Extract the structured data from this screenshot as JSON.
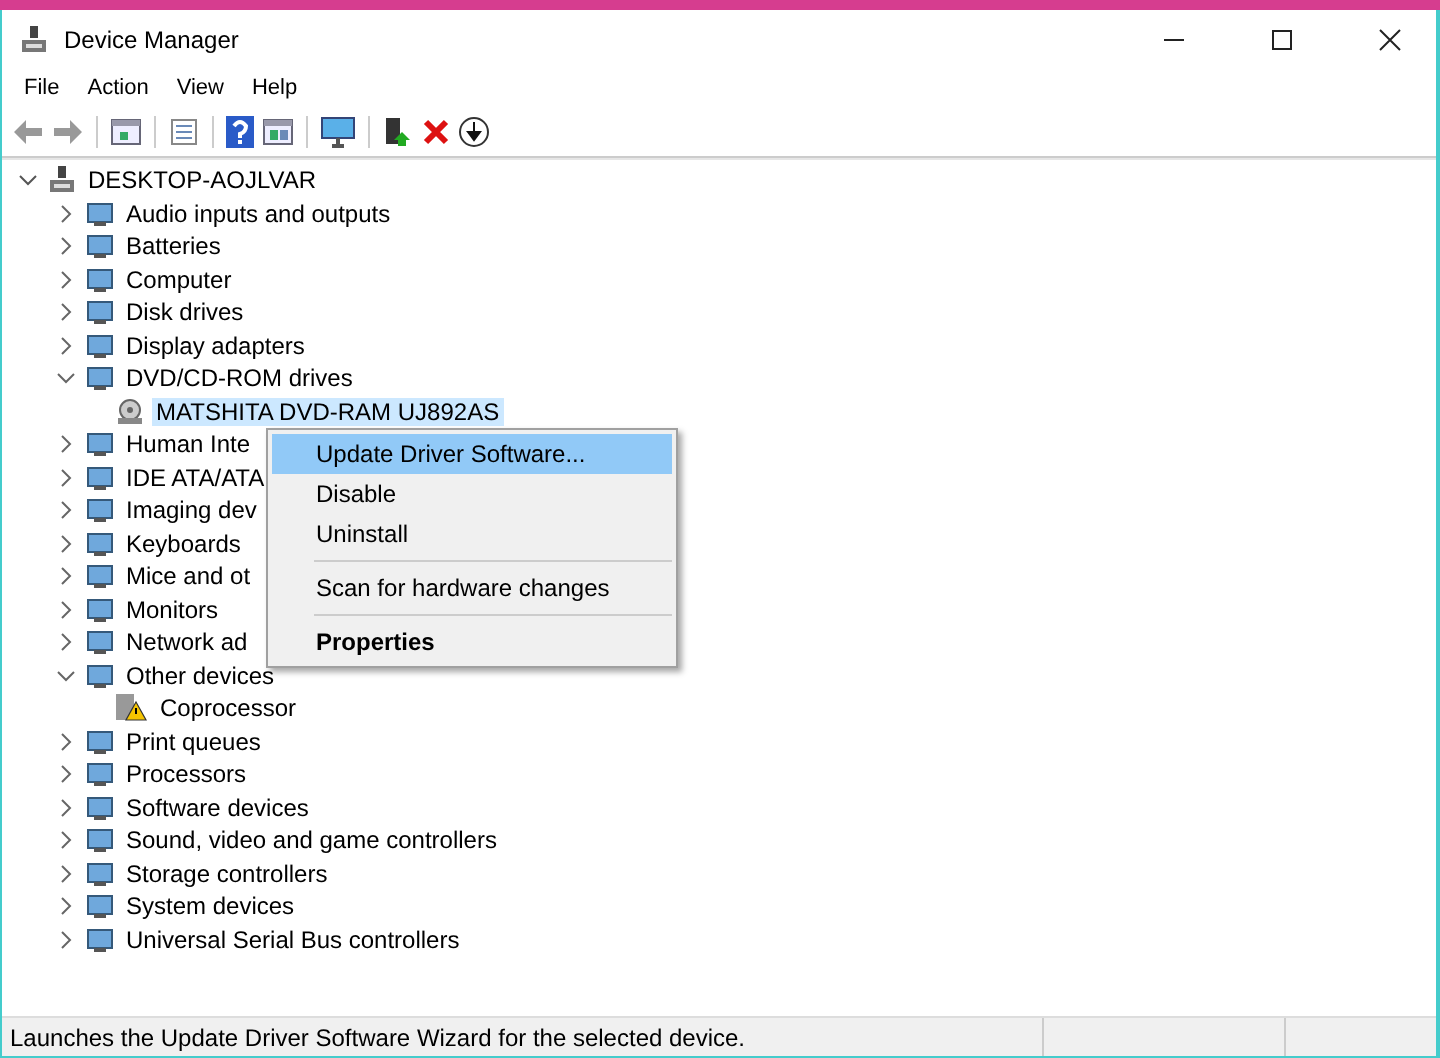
{
  "window": {
    "title": "Device Manager"
  },
  "menu_bar": [
    "File",
    "Action",
    "View",
    "Help"
  ],
  "tree": {
    "label": "DESKTOP-AOJLVAR",
    "expanded": true,
    "selected": false,
    "children": [
      {
        "label": "Audio inputs and outputs",
        "expanded": false,
        "selected": false
      },
      {
        "label": "Batteries",
        "expanded": false,
        "selected": false
      },
      {
        "label": "Computer",
        "expanded": false,
        "selected": false
      },
      {
        "label": "Disk drives",
        "expanded": false,
        "selected": false
      },
      {
        "label": "Display adapters",
        "expanded": false,
        "selected": false
      },
      {
        "label": "DVD/CD-ROM drives",
        "expanded": true,
        "selected": false,
        "children": [
          {
            "label": "MATSHITA DVD-RAM UJ892AS",
            "selected": true,
            "warning": false
          }
        ]
      },
      {
        "label": "Human Inte",
        "expanded": false,
        "selected": false
      },
      {
        "label": "IDE ATA/ATA",
        "expanded": false,
        "selected": false
      },
      {
        "label": "Imaging dev",
        "expanded": false,
        "selected": false
      },
      {
        "label": "Keyboards",
        "expanded": false,
        "selected": false
      },
      {
        "label": "Mice and ot",
        "expanded": false,
        "selected": false
      },
      {
        "label": "Monitors",
        "expanded": false,
        "selected": false
      },
      {
        "label": "Network ad",
        "expanded": false,
        "selected": false
      },
      {
        "label": "Other devices",
        "expanded": true,
        "selected": false,
        "children": [
          {
            "label": "Coprocessor",
            "selected": false,
            "warning": true
          }
        ]
      },
      {
        "label": "Print queues",
        "expanded": false,
        "selected": false
      },
      {
        "label": "Processors",
        "expanded": false,
        "selected": false
      },
      {
        "label": "Software devices",
        "expanded": false,
        "selected": false
      },
      {
        "label": "Sound, video and game controllers",
        "expanded": false,
        "selected": false
      },
      {
        "label": "Storage controllers",
        "expanded": false,
        "selected": false
      },
      {
        "label": "System devices",
        "expanded": false,
        "selected": false
      },
      {
        "label": "Universal Serial Bus controllers",
        "expanded": false,
        "selected": false
      }
    ]
  },
  "context_menu": [
    {
      "kind": "item",
      "label": "Update Driver Software...",
      "selected": true
    },
    {
      "kind": "item",
      "label": "Disable",
      "selected": false
    },
    {
      "kind": "item",
      "label": "Uninstall",
      "selected": false
    },
    {
      "kind": "separator"
    },
    {
      "kind": "item",
      "label": "Scan for hardware changes",
      "selected": false
    },
    {
      "kind": "separator"
    },
    {
      "kind": "default",
      "label": "Properties",
      "selected": false
    }
  ],
  "status_bar": "Launches the Update Driver Software Wizard for the selected device."
}
